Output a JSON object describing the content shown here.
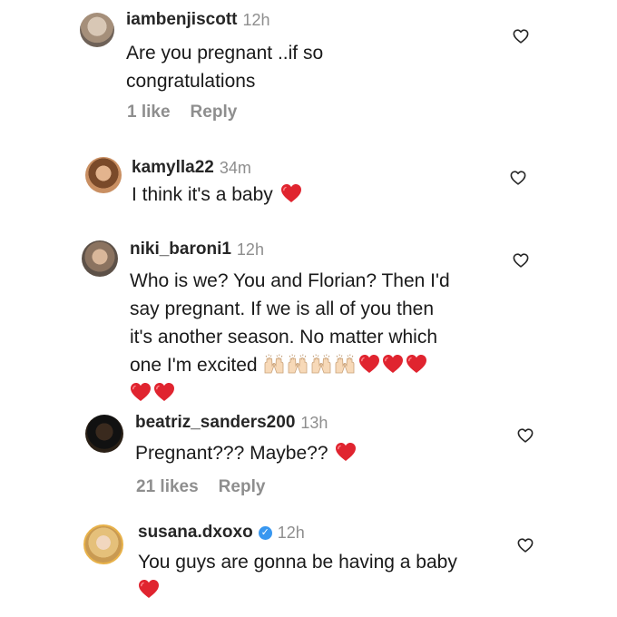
{
  "comments": [
    {
      "username": "iambenjiscott",
      "time": "12h",
      "lines": [
        "Are you pregnant ..if so",
        "congratulations"
      ],
      "likes": "1 like",
      "reply": "Reply"
    },
    {
      "username": "kamylla22",
      "time": "34m",
      "lines": [
        "I think it's a baby"
      ]
    },
    {
      "username": "niki_baroni1",
      "time": "12h",
      "lines": [
        "Who is we? You and Florian? Then I'd",
        "say pregnant. If we is all of you then",
        "it's another season. No matter which",
        "one I'm excited"
      ]
    },
    {
      "username": "beatriz_sanders200",
      "time": "13h",
      "lines": [
        "Pregnant??? Maybe??"
      ],
      "likes": "21 likes",
      "reply": "Reply"
    },
    {
      "username": "susana.dxoxo",
      "time": "12h",
      "verified": "✓",
      "lines": [
        "You guys are gonna be having a baby"
      ]
    }
  ],
  "colors": {
    "heart_emoji": "#e0242f",
    "username": "#262626",
    "secondary": "#8e8e8e",
    "verified": "#3897f0"
  },
  "icons": {
    "like": "heart-outline-icon",
    "heart_emoji": "red-heart-emoji",
    "hands_emoji": "raising-hands-emoji"
  }
}
